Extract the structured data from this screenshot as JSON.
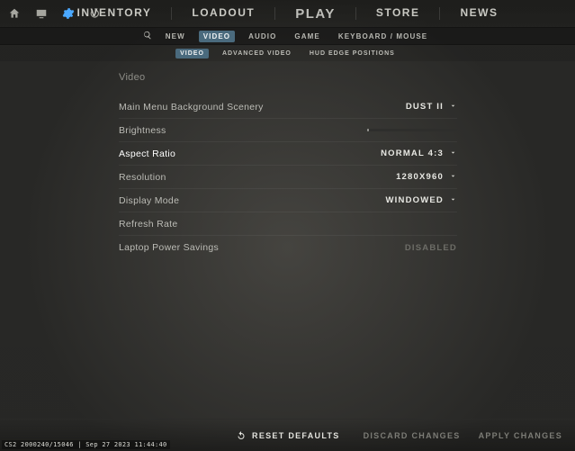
{
  "topnav": {
    "inventory": "INVENTORY",
    "loadout": "LOADOUT",
    "play": "PLAY",
    "store": "STORE",
    "news": "NEWS"
  },
  "subtabs": {
    "new": "NEW",
    "video": "VIDEO",
    "audio": "AUDIO",
    "game": "GAME",
    "keyboard": "KEYBOARD / MOUSE"
  },
  "videotabs": {
    "video": "VIDEO",
    "advanced": "ADVANCED VIDEO",
    "hud": "HUD EDGE POSITIONS"
  },
  "section": {
    "title": "Video",
    "scenery": {
      "label": "Main Menu Background Scenery",
      "value": "DUST II"
    },
    "brightness": {
      "label": "Brightness"
    },
    "aspect": {
      "label": "Aspect Ratio",
      "value": "NORMAL 4:3"
    },
    "resolution": {
      "label": "Resolution",
      "value": "1280X960"
    },
    "display": {
      "label": "Display Mode",
      "value": "WINDOWED"
    },
    "refresh": {
      "label": "Refresh Rate"
    },
    "laptop": {
      "label": "Laptop Power Savings",
      "value": "DISABLED"
    }
  },
  "bottom": {
    "reset": "RESET DEFAULTS",
    "discard": "DISCARD CHANGES",
    "apply": "APPLY CHANGES"
  },
  "debug": "CS2 2000240/15046 | Sep 27 2023 11:44:40"
}
